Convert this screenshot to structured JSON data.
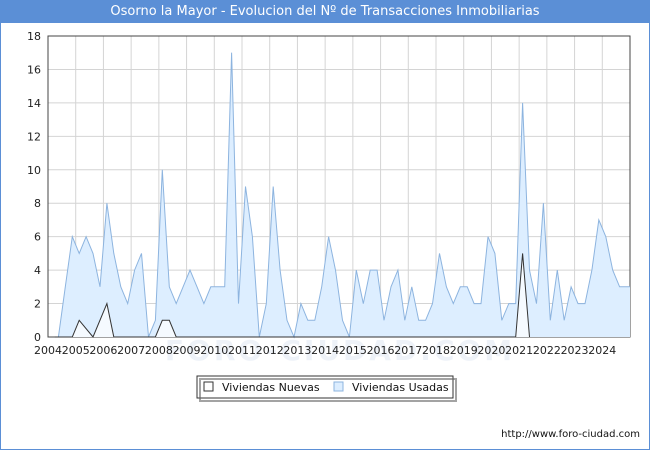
{
  "title": "Osorno la Mayor - Evolucion del Nº de Transacciones Inmobiliarias",
  "footer": "http://www.foro-ciudad.com",
  "watermark": "FORO-CIUDAD.COM",
  "colors": {
    "title_bg": "#5b8fd6",
    "usadas_fill": "#ddeeff",
    "usadas_line": "#8db4df",
    "nuevas_line": "#333333"
  },
  "chart_data": {
    "type": "area",
    "title": "Osorno la Mayor - Evolucion del Nº de Transacciones Inmobiliarias",
    "xlabel": "",
    "ylabel": "",
    "x_ticks": [
      "2004",
      "2005",
      "2006",
      "2007",
      "2008",
      "2009",
      "2010",
      "2011",
      "2012",
      "2013",
      "2014",
      "2015",
      "2016",
      "2017",
      "2018",
      "2019",
      "2020",
      "2021",
      "2022",
      "2023",
      "2024"
    ],
    "y_ticks": [
      0,
      2,
      4,
      6,
      8,
      10,
      12,
      14,
      16,
      18
    ],
    "ylim": [
      0,
      18
    ],
    "xlim": [
      2004.0,
      2025.0
    ],
    "grid": true,
    "legend_position": "bottom",
    "series": [
      {
        "name": "Viviendas Nuevas",
        "x": [
          2004.25,
          2004.875,
          2005.125,
          2005.625,
          2006.125,
          2006.375,
          2007.875,
          2008.125,
          2008.375,
          2008.625,
          2020.875,
          2021.125,
          2021.375
        ],
        "values": [
          0,
          0,
          1,
          0,
          2,
          0,
          0,
          1,
          1,
          0,
          0,
          5,
          0
        ]
      },
      {
        "name": "Viviendas Usadas",
        "x": [
          2004.375,
          2004.625,
          2004.875,
          2005.125,
          2005.375,
          2005.625,
          2005.875,
          2006.125,
          2006.375,
          2006.625,
          2006.875,
          2007.125,
          2007.375,
          2007.625,
          2007.875,
          2008.125,
          2008.375,
          2008.625,
          2008.875,
          2009.125,
          2009.375,
          2009.625,
          2009.875,
          2010.125,
          2010.375,
          2010.625,
          2010.875,
          2011.125,
          2011.375,
          2011.625,
          2011.875,
          2012.125,
          2012.375,
          2012.625,
          2012.875,
          2013.125,
          2013.375,
          2013.625,
          2013.875,
          2014.125,
          2014.375,
          2014.625,
          2014.875,
          2015.125,
          2015.375,
          2015.625,
          2015.875,
          2016.125,
          2016.375,
          2016.625,
          2016.875,
          2017.125,
          2017.375,
          2017.625,
          2017.875,
          2018.125,
          2018.375,
          2018.625,
          2018.875,
          2019.125,
          2019.375,
          2019.625,
          2019.875,
          2020.125,
          2020.375,
          2020.625,
          2020.875,
          2021.125,
          2021.375,
          2021.625,
          2021.875,
          2022.125,
          2022.375,
          2022.625,
          2022.875,
          2023.125,
          2023.375,
          2023.625,
          2023.875,
          2024.125,
          2024.375,
          2024.625,
          2024.875
        ],
        "values": [
          0,
          3,
          6,
          5,
          6,
          5,
          3,
          8,
          5,
          3,
          2,
          4,
          5,
          0,
          1,
          10,
          3,
          2,
          3,
          4,
          3,
          2,
          3,
          3,
          3,
          17,
          2,
          9,
          6,
          0,
          2,
          9,
          4,
          1,
          0,
          2,
          1,
          1,
          3,
          6,
          4,
          1,
          0,
          4,
          2,
          4,
          4,
          1,
          3,
          4,
          1,
          3,
          1,
          1,
          2,
          5,
          3,
          2,
          3,
          3,
          2,
          2,
          6,
          5,
          1,
          2,
          2,
          14,
          4,
          2,
          8,
          1,
          4,
          1,
          3,
          2,
          2,
          4,
          7,
          6,
          4,
          3,
          3
        ]
      }
    ]
  }
}
